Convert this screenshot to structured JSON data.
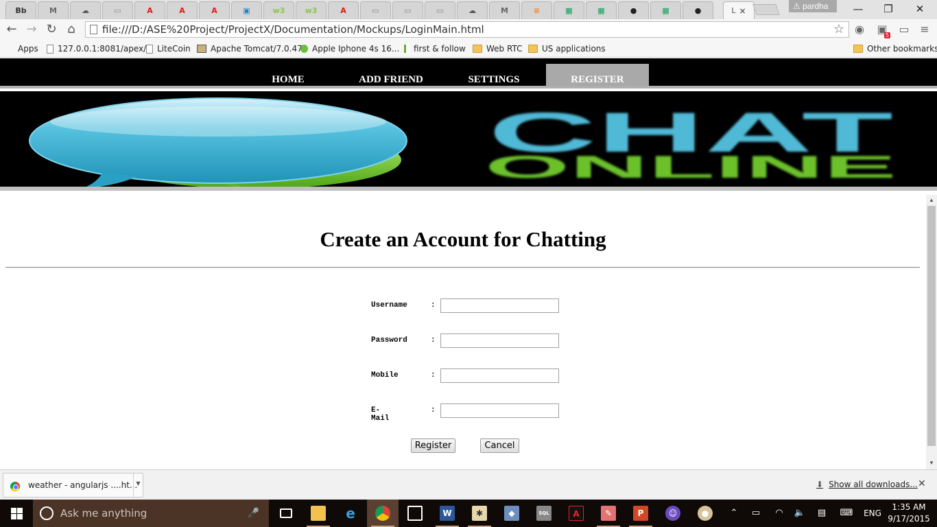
{
  "browser": {
    "tabs": [
      {
        "glyph": "Bb",
        "color": "#333333"
      },
      {
        "glyph": "M",
        "color": "#666666"
      },
      {
        "glyph": "☁",
        "color": "#555555"
      },
      {
        "glyph": "▭",
        "color": "#888888"
      },
      {
        "glyph": "A",
        "color": "#dd1b16"
      },
      {
        "glyph": "A",
        "color": "#dd1b16"
      },
      {
        "glyph": "A",
        "color": "#dd1b16"
      },
      {
        "glyph": "▣",
        "color": "#1e88c8"
      },
      {
        "glyph": "w3",
        "color": "#8bc34a"
      },
      {
        "glyph": "w3",
        "color": "#8bc34a"
      },
      {
        "glyph": "A",
        "color": "#dd1b16"
      },
      {
        "glyph": "▭",
        "color": "#888888"
      },
      {
        "glyph": "▭",
        "color": "#888888"
      },
      {
        "glyph": "▭",
        "color": "#888888"
      },
      {
        "glyph": "☁",
        "color": "#555555"
      },
      {
        "glyph": "M",
        "color": "#666666"
      },
      {
        "glyph": "≡",
        "color": "#f48024"
      },
      {
        "glyph": "▦",
        "color": "#0f9d58"
      },
      {
        "glyph": "▦",
        "color": "#0f9d58"
      },
      {
        "glyph": "●",
        "color": "#222222"
      },
      {
        "glyph": "▦",
        "color": "#0f9d58"
      },
      {
        "glyph": "●",
        "color": "#222222"
      }
    ],
    "active_tab": {
      "title": "L",
      "close": "×"
    },
    "profile_name": "pardha",
    "window_controls": {
      "minimize": "—",
      "restore": "❐",
      "close": "✕"
    },
    "nav": {
      "back": "←",
      "forward": "→",
      "reload": "↻",
      "home": "⌂"
    },
    "url": "file:///D:/ASE%20Project/ProjectX/Documentation/Mockups/LoginMain.html",
    "star": "☆",
    "extensions": {
      "badge": "5",
      "menu": "≡"
    },
    "bookmarks": [
      {
        "label": "Apps",
        "icon": "apps-icon"
      },
      {
        "label": "127.0.0.1:8081/apex/",
        "icon": "page-icon"
      },
      {
        "label": "LiteCoin",
        "icon": "page-icon"
      },
      {
        "label": "Apache Tomcat/7.0.47",
        "icon": "tomcat-icon"
      },
      {
        "label": "Apple Iphone 4s 16...",
        "icon": "qualcomm-icon"
      },
      {
        "label": "first & follow",
        "icon": "j-icon"
      },
      {
        "label": "Web RTC",
        "icon": "folder-icon"
      },
      {
        "label": "US applications",
        "icon": "folder-icon"
      }
    ],
    "other_bookmarks": "Other bookmarks"
  },
  "site": {
    "nav_items": [
      {
        "label": "HOME",
        "active": false
      },
      {
        "label": "ADD FRIEND",
        "active": false
      },
      {
        "label": "SETTINGS",
        "active": false
      },
      {
        "label": "REGISTER",
        "active": true
      }
    ],
    "banner": {
      "line1": "CHAT",
      "line2": "ONLINE"
    },
    "form": {
      "title": "Create an Account for Chatting",
      "fields": [
        {
          "label": "Username",
          "colon": ":",
          "value": ""
        },
        {
          "label": "Password",
          "colon": ":",
          "value": ""
        },
        {
          "label": "Mobile",
          "colon": ":",
          "value": ""
        },
        {
          "label": "E-Mail",
          "colon": ":",
          "value": ""
        }
      ],
      "register_label": "Register",
      "cancel_label": "Cancel"
    }
  },
  "download_shelf": {
    "item_name": "weather - angularjs ....ht...",
    "show_all": "Show all downloads...",
    "close": "✕"
  },
  "taskbar": {
    "search_placeholder": "Ask me anything",
    "language": "ENG",
    "time": "1:35 AM",
    "date": "9/17/2015"
  },
  "colors": {
    "nav_bg": "#000000",
    "nav_active": "#a9a9a9",
    "banner_blue": "#4fb9d6",
    "banner_green": "#6cc12b"
  }
}
